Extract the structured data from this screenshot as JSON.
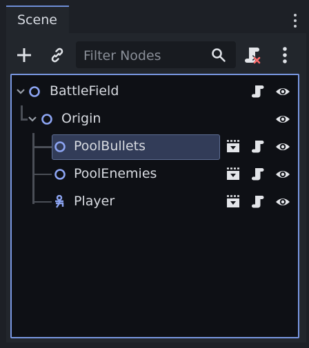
{
  "tab": {
    "title": "Scene"
  },
  "toolbar": {
    "add_icon": "plus-icon",
    "link_icon": "link-icon",
    "filter_placeholder": "Filter Nodes",
    "filter_value": "",
    "search_icon": "search-icon",
    "script_icon": "script-remove-icon",
    "menu_icon": "kebab-icon"
  },
  "tree": {
    "nodes": [
      {
        "label": "BattleField",
        "icon": "node-circle-icon",
        "expanded": true,
        "actions": [
          "script-icon",
          "visibility-icon"
        ]
      },
      {
        "label": "Origin",
        "icon": "node-circle-icon",
        "expanded": true,
        "actions": [
          "visibility-icon"
        ]
      },
      {
        "label": "PoolBullets",
        "icon": "node-circle-icon",
        "selected": true,
        "actions": [
          "instance-scene-icon",
          "script-icon",
          "visibility-icon"
        ]
      },
      {
        "label": "PoolEnemies",
        "icon": "node-circle-icon",
        "actions": [
          "instance-scene-icon",
          "script-icon",
          "visibility-icon"
        ]
      },
      {
        "label": "Player",
        "icon": "character-body-icon",
        "actions": [
          "instance-scene-icon",
          "script-icon",
          "visibility-icon"
        ]
      }
    ]
  },
  "colors": {
    "accent": "#7a98e3",
    "node_icon": "#8da5f3",
    "selection": "#323c58",
    "tree_bg": "#0e1015",
    "panel_bg": "#22262c"
  }
}
